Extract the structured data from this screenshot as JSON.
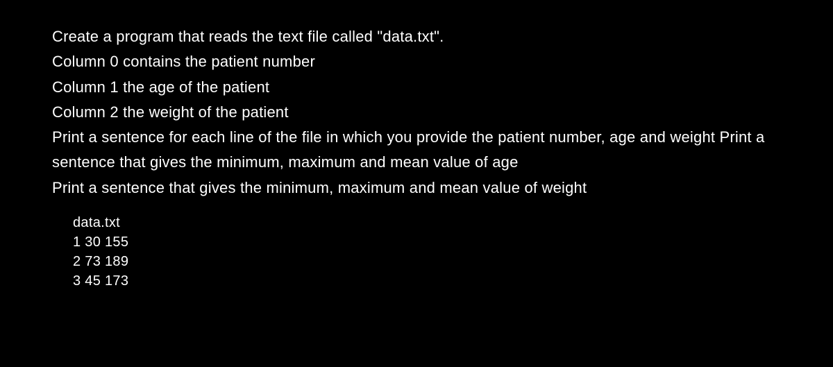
{
  "problem": {
    "line1": "Create a program that reads the text file called \"data.txt\".",
    "line2": "Column 0 contains the patient number",
    "line3": "Column 1 the age of the patient",
    "line4": "Column 2 the weight of the patient",
    "line5": "Print a sentence for each line of the file in which you provide the patient number, age and weight Print a sentence that gives the minimum, maximum and mean value of age",
    "line6": "Print a sentence that gives the minimum, maximum and mean value of weight"
  },
  "data_file": {
    "filename": "data.txt",
    "row1": "1 30 155",
    "row2": "2 73 189",
    "row3": "3 45 173"
  }
}
